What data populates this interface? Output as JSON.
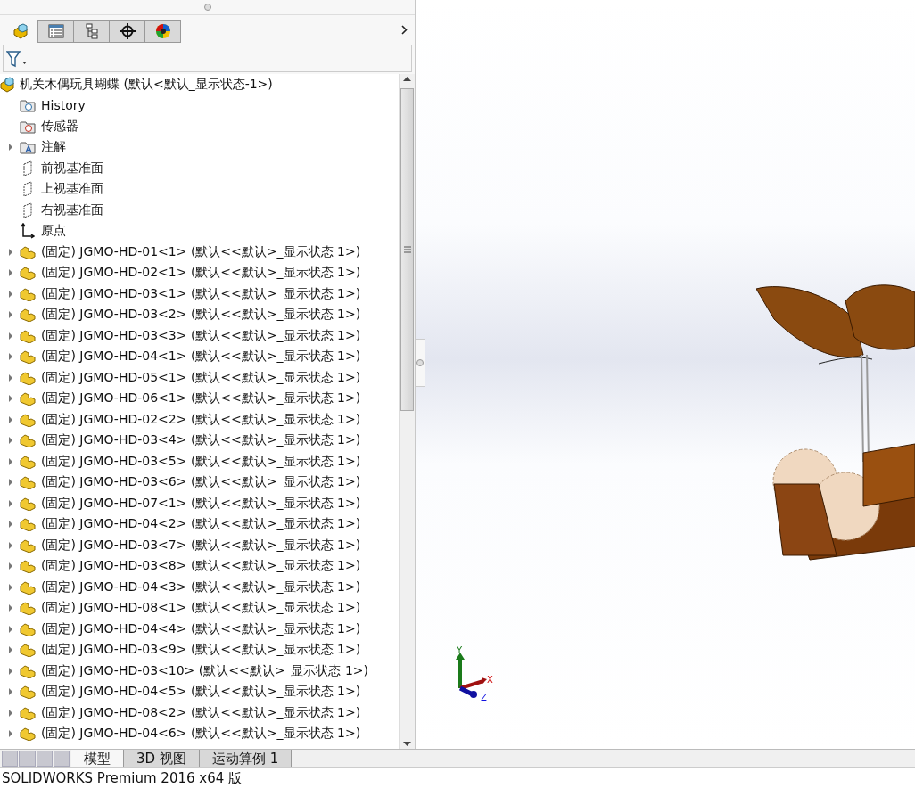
{
  "panel_tabs": [
    {
      "kind": "assembly",
      "selected": true
    },
    {
      "kind": "properties",
      "selected": false
    },
    {
      "kind": "config",
      "selected": false
    },
    {
      "kind": "dimxpert",
      "selected": false
    },
    {
      "kind": "display",
      "selected": false
    }
  ],
  "tree": {
    "label": "机关木偶玩具蝴蝶  (默认<默认_显示状态-1>)",
    "children": [
      {
        "kind": "history",
        "label": "History"
      },
      {
        "kind": "sensors",
        "label": "传感器"
      },
      {
        "kind": "annotations",
        "label": "注解",
        "expanded": false
      },
      {
        "kind": "plane",
        "label": "前视基准面"
      },
      {
        "kind": "plane",
        "label": "上视基准面"
      },
      {
        "kind": "plane",
        "label": "右视基准面"
      },
      {
        "kind": "origin",
        "label": "原点"
      },
      {
        "kind": "part",
        "label": "(固定) JGMO-HD-01<1> (默认<<默认>_显示状态 1>)",
        "expanded": false
      },
      {
        "kind": "part",
        "label": "(固定) JGMO-HD-02<1> (默认<<默认>_显示状态 1>)",
        "expanded": false
      },
      {
        "kind": "part",
        "label": "(固定) JGMO-HD-03<1> (默认<<默认>_显示状态 1>)",
        "expanded": false
      },
      {
        "kind": "part",
        "label": "(固定) JGMO-HD-03<2> (默认<<默认>_显示状态 1>)",
        "expanded": false
      },
      {
        "kind": "part",
        "label": "(固定) JGMO-HD-03<3> (默认<<默认>_显示状态 1>)",
        "expanded": false
      },
      {
        "kind": "part",
        "label": "(固定) JGMO-HD-04<1> (默认<<默认>_显示状态 1>)",
        "expanded": false
      },
      {
        "kind": "part",
        "label": "(固定) JGMO-HD-05<1> (默认<<默认>_显示状态 1>)",
        "expanded": false
      },
      {
        "kind": "part",
        "label": "(固定) JGMO-HD-06<1> (默认<<默认>_显示状态 1>)",
        "expanded": false
      },
      {
        "kind": "part",
        "label": "(固定) JGMO-HD-02<2> (默认<<默认>_显示状态 1>)",
        "expanded": false
      },
      {
        "kind": "part",
        "label": "(固定) JGMO-HD-03<4> (默认<<默认>_显示状态 1>)",
        "expanded": false
      },
      {
        "kind": "part",
        "label": "(固定) JGMO-HD-03<5> (默认<<默认>_显示状态 1>)",
        "expanded": false
      },
      {
        "kind": "part",
        "label": "(固定) JGMO-HD-03<6> (默认<<默认>_显示状态 1>)",
        "expanded": false
      },
      {
        "kind": "part",
        "label": "(固定) JGMO-HD-07<1> (默认<<默认>_显示状态 1>)",
        "expanded": false
      },
      {
        "kind": "part",
        "label": "(固定) JGMO-HD-04<2> (默认<<默认>_显示状态 1>)",
        "expanded": false
      },
      {
        "kind": "part",
        "label": "(固定) JGMO-HD-03<7> (默认<<默认>_显示状态 1>)",
        "expanded": false
      },
      {
        "kind": "part",
        "label": "(固定) JGMO-HD-03<8> (默认<<默认>_显示状态 1>)",
        "expanded": false
      },
      {
        "kind": "part",
        "label": "(固定) JGMO-HD-04<3> (默认<<默认>_显示状态 1>)",
        "expanded": false
      },
      {
        "kind": "part",
        "label": "(固定) JGMO-HD-08<1> (默认<<默认>_显示状态 1>)",
        "expanded": false
      },
      {
        "kind": "part",
        "label": "(固定) JGMO-HD-04<4> (默认<<默认>_显示状态 1>)",
        "expanded": false
      },
      {
        "kind": "part",
        "label": "(固定) JGMO-HD-03<9> (默认<<默认>_显示状态 1>)",
        "expanded": false
      },
      {
        "kind": "part",
        "label": "(固定) JGMO-HD-03<10> (默认<<默认>_显示状态 1>)",
        "expanded": false
      },
      {
        "kind": "part",
        "label": "(固定) JGMO-HD-04<5> (默认<<默认>_显示状态 1>)",
        "expanded": false
      },
      {
        "kind": "part",
        "label": "(固定) JGMO-HD-08<2> (默认<<默认>_显示状态 1>)",
        "expanded": false
      },
      {
        "kind": "part",
        "label": "(固定) JGMO-HD-04<6> (默认<<默认>_显示状态 1>)",
        "expanded": false
      }
    ]
  },
  "bottom_tabs": [
    {
      "label": "模型",
      "selected": true
    },
    {
      "label": "3D 视图",
      "selected": false
    },
    {
      "label": "运动算例 1",
      "selected": false
    }
  ],
  "triad": {
    "x": "X",
    "y": "Y",
    "z": "Z"
  },
  "status_bar": "SOLIDWORKS Premium 2016 x64 版"
}
